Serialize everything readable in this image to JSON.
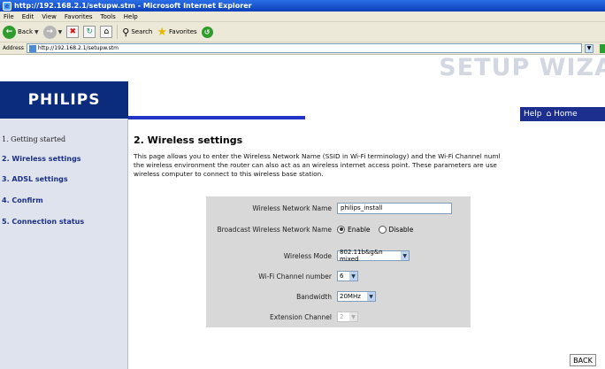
{
  "window": {
    "title": "http://192.168.2.1/setupw.stm - Microsoft Internet Explorer"
  },
  "menu": [
    "File",
    "Edit",
    "View",
    "Favorites",
    "Tools",
    "Help"
  ],
  "toolbar": {
    "back_label": "Back",
    "search_label": "Search",
    "favorites_label": "Favorites"
  },
  "address": {
    "label": "Address",
    "url": "http://192.168.2.1/setupw.stm"
  },
  "header": {
    "brand": "PHILIPS",
    "banner": "SETUP WIZA",
    "help": "Help",
    "home": "Home"
  },
  "sidebar": {
    "items": [
      {
        "label": "1. Getting started"
      },
      {
        "label": "2. Wireless settings"
      },
      {
        "label": "3. ADSL settings"
      },
      {
        "label": "4. Confirm"
      },
      {
        "label": "5. Connection status"
      }
    ]
  },
  "main": {
    "title": "2. Wireless settings",
    "description_lines": [
      "This page allows you to enter the Wireless Network Name (SSID in Wi-Fi terminology) and the Wi-Fi Channel numl",
      "the wireless environment the router can also act as an wireless internet access point. These parameters are use",
      "wireless computer to connect to this wireless base station."
    ],
    "form": {
      "ssid_label": "Wireless Network Name",
      "ssid_value": "philips_install",
      "broadcast_label": "Broadcast Wireless Network Name",
      "broadcast_enable": "Enable",
      "broadcast_disable": "Disable",
      "mode_label": "Wireless Mode",
      "mode_value": "802.11b&g&n mixed",
      "channel_label": "Wi-Fi Channel number",
      "channel_value": "6",
      "bandwidth_label": "Bandwidth",
      "bandwidth_value": "20MHz",
      "ext_label": "Extension Channel",
      "ext_value": "2"
    },
    "back_button": "BACK"
  }
}
